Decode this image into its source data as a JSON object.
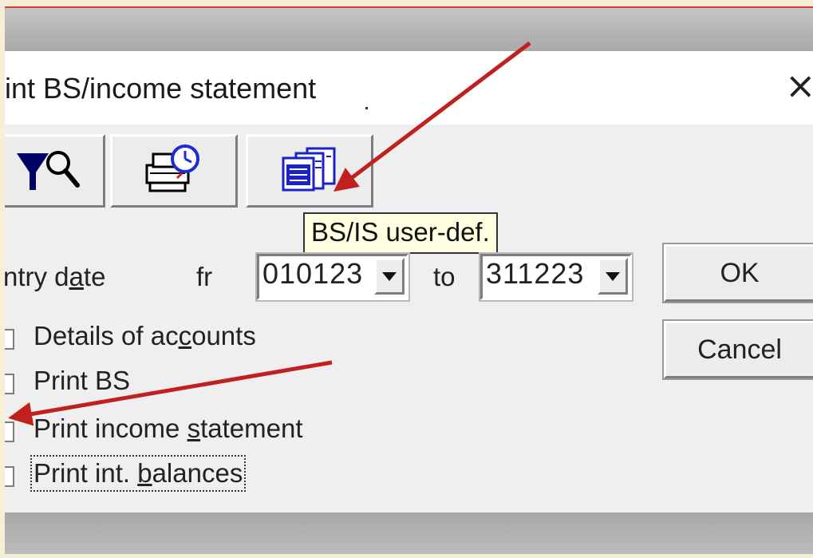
{
  "dialog": {
    "title": "int BS/income statement",
    "close_symbol": "×"
  },
  "toolbar": {
    "buttons": [
      {
        "icon": "filter-search-icon"
      },
      {
        "icon": "print-schedule-icon"
      },
      {
        "icon": "bs-is-user-defined-icon"
      }
    ],
    "tooltip": "BS/IS user-def."
  },
  "entry_date": {
    "label_pre": "ntry d",
    "label_underlined": "a",
    "label_post": "te",
    "from_label": "fr",
    "from_value": "010123",
    "to_label": "to",
    "to_value": "311223"
  },
  "buttons": {
    "ok": "OK",
    "cancel": "Cancel"
  },
  "options": [
    {
      "pre": "Details of ac",
      "u": "c",
      "post": "ounts"
    },
    {
      "pre": "Print BS",
      "u": "",
      "post": ""
    },
    {
      "pre": "Print income ",
      "u": "s",
      "post": "tatement"
    },
    {
      "pre": "Print int. ",
      "u": "b",
      "post": "alances"
    }
  ],
  "annotation": {
    "arrow_color": "#c0211f"
  }
}
